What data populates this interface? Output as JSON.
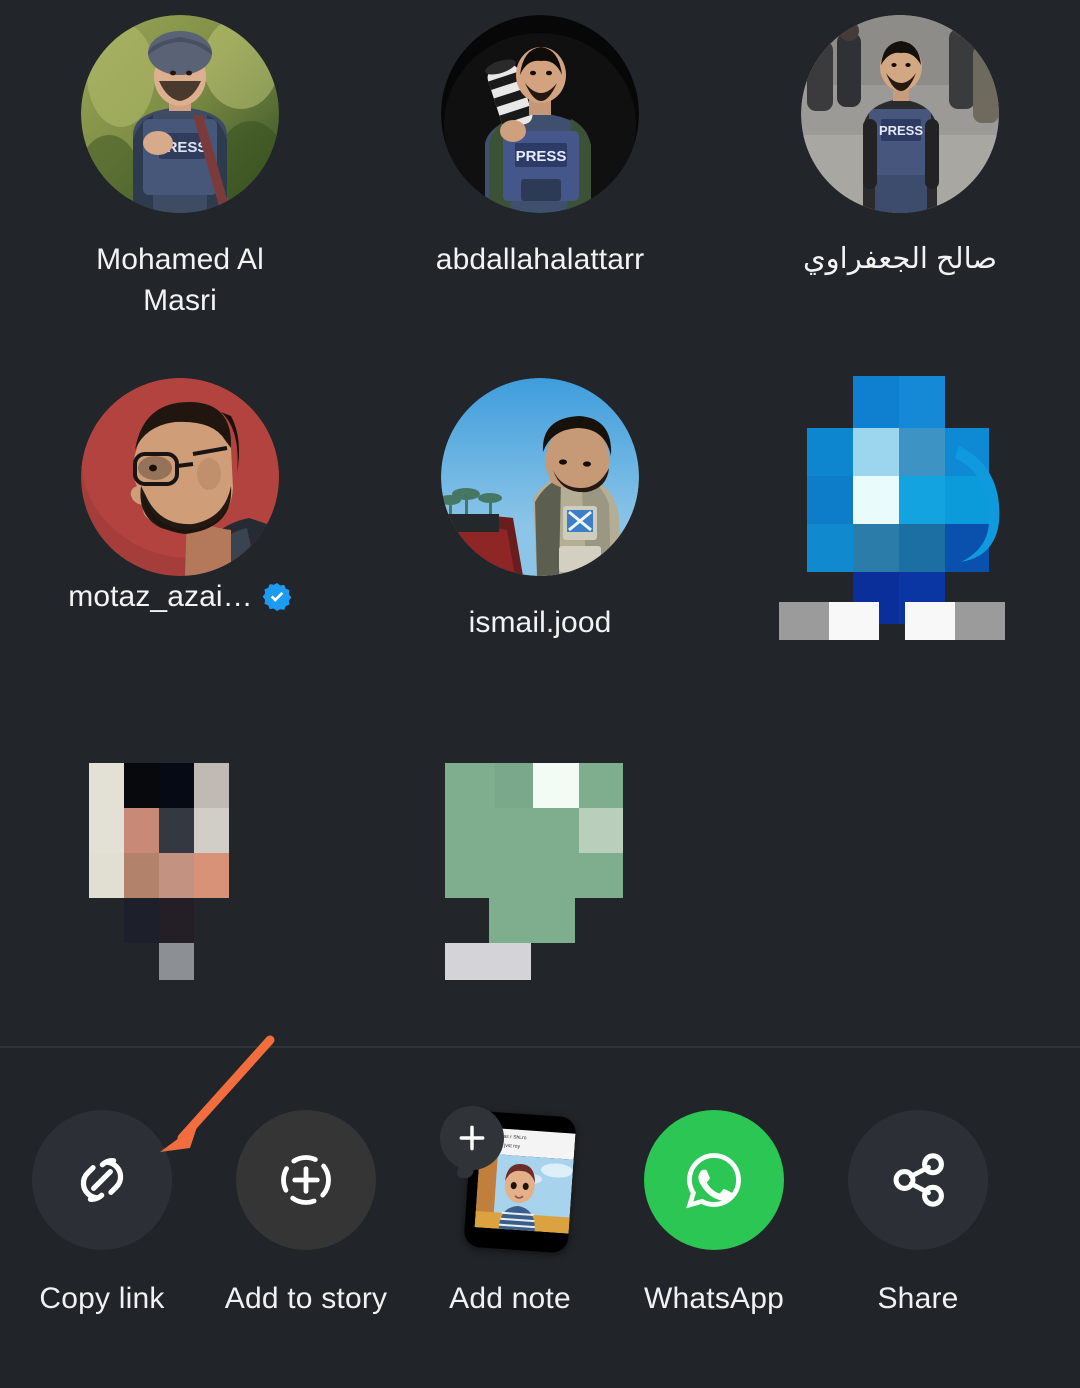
{
  "theme": {
    "background": "#222529",
    "sheet_background": "#212428",
    "divider": "#303438",
    "text_primary": "#f2f3f4",
    "verified_blue": "#1d9bf0",
    "whatsapp_green": "#2bc653",
    "annotation_arrow": "#f26d3d",
    "share_circle_bg": "#2c3036",
    "share_circle_bg_alt": "#353535"
  },
  "contacts": {
    "rows": [
      [
        {
          "name": "Mohamed Al Masri",
          "avatar": "photo-journalist-press-vest-green-foliage",
          "verified": false,
          "censored": false,
          "rtl": false
        },
        {
          "name": "abdallahalattarr",
          "avatar": "photo-journalist-press-vest-camera-black-background",
          "verified": false,
          "censored": false,
          "rtl": false
        },
        {
          "name": "صالح الجعفراوي",
          "avatar": "photo-journalist-press-vest-street-crowd",
          "verified": false,
          "censored": false,
          "rtl": true
        }
      ],
      [
        {
          "name": "motaz_azai…",
          "avatar": "photo-man-glasses-beard-red-background",
          "verified": true,
          "censored": false,
          "rtl": false
        },
        {
          "name": "ismail.jood",
          "avatar": "photo-man-vest-blue-sky-looking-down",
          "verified": false,
          "censored": false,
          "rtl": false
        },
        {
          "name": "",
          "avatar": "censored-blue-mosaic-avatar",
          "verified": false,
          "censored": true,
          "rtl": false
        }
      ],
      [
        {
          "name": "",
          "avatar": "censored-skin-tone-mosaic-avatar",
          "verified": false,
          "censored": true,
          "rtl": false
        },
        {
          "name": "",
          "avatar": "censored-green-mosaic-avatar",
          "verified": false,
          "censored": true,
          "rtl": false
        }
      ]
    ]
  },
  "share_sheet": {
    "actions": [
      {
        "label": "Copy link",
        "icon": "link-icon",
        "highlighted": true
      },
      {
        "label": "Add to story",
        "icon": "add-to-story-icon",
        "highlighted": false
      },
      {
        "label": "Add note",
        "icon": "add-note-icon",
        "highlighted": false
      },
      {
        "label": "WhatsApp",
        "icon": "whatsapp-icon",
        "highlighted": false
      },
      {
        "label": "Share",
        "icon": "share-nodes-icon",
        "highlighted": false
      }
    ]
  },
  "annotation": {
    "type": "arrow",
    "color": "#f26d3d",
    "points_to": "Copy link"
  }
}
